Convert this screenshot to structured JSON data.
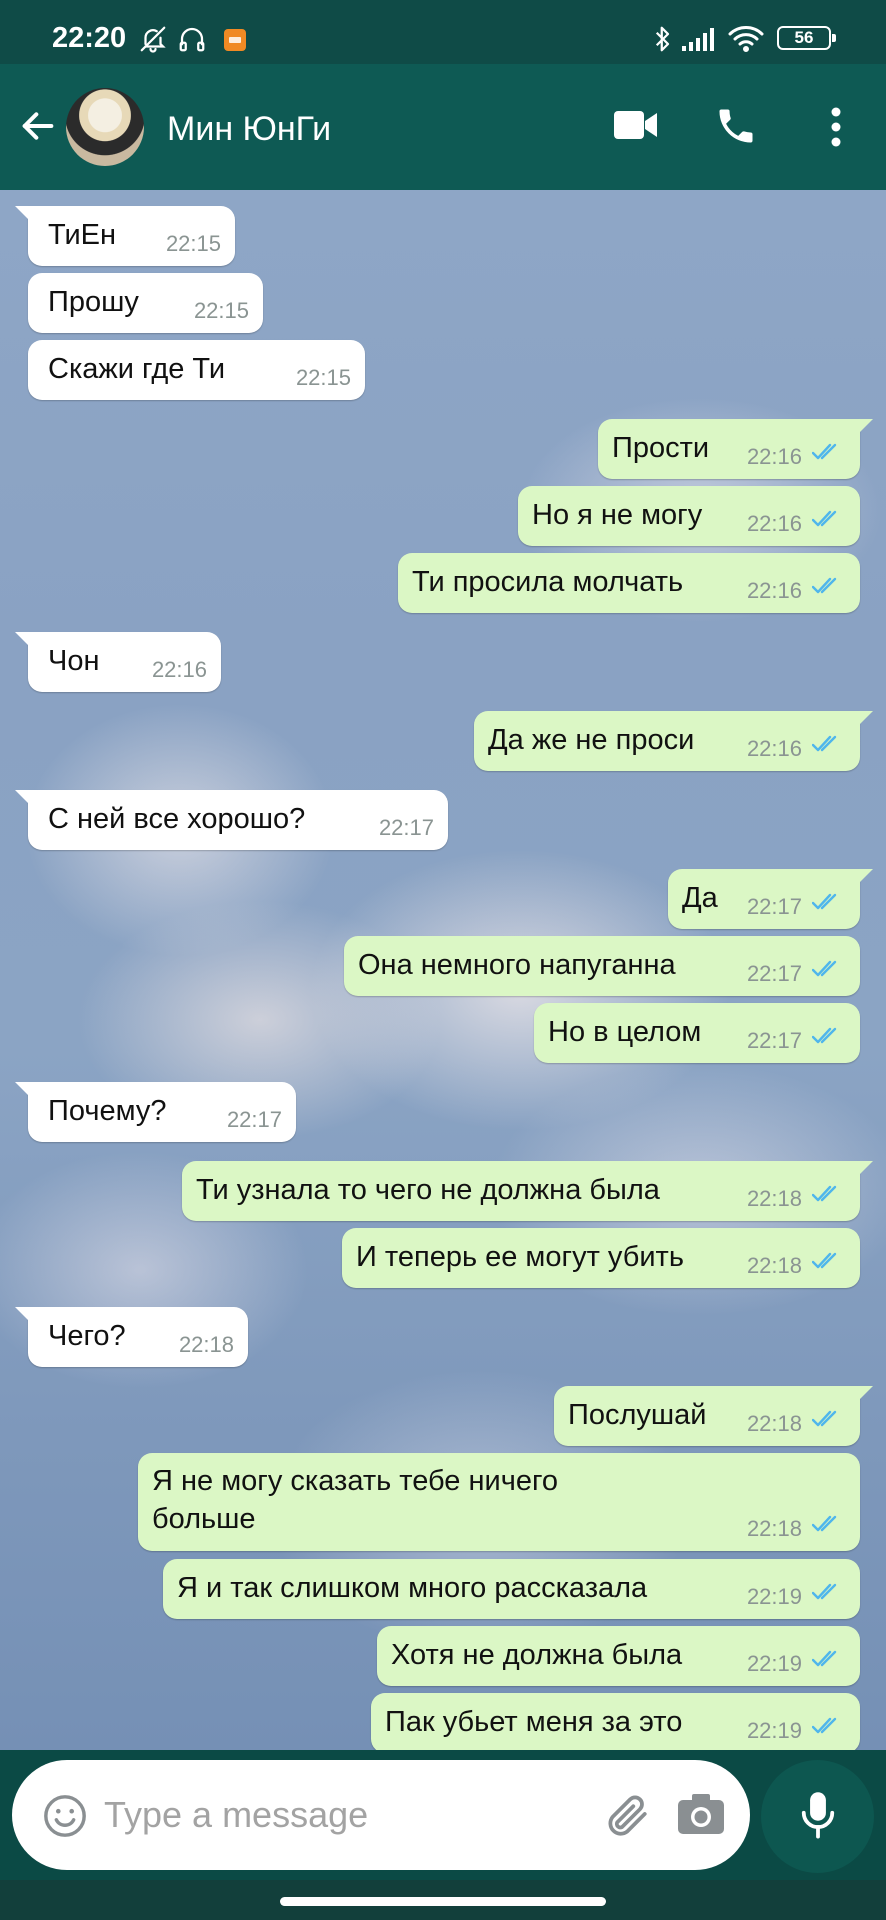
{
  "status_bar": {
    "time": "22:20",
    "battery": "56",
    "icons": [
      "bell-off-icon",
      "headphones-icon",
      "app-notification-icon",
      "bluetooth-icon",
      "signal-icon",
      "wifi-icon",
      "battery-icon"
    ]
  },
  "header": {
    "contact_name": "Мин ЮнГи",
    "icons": [
      "back-arrow-icon",
      "video-call-icon",
      "phone-call-icon",
      "more-vert-icon"
    ]
  },
  "messages": [
    {
      "dir": "in",
      "text": "ТиЕн",
      "time": "22:15"
    },
    {
      "dir": "in",
      "text": "Прошу",
      "time": "22:15"
    },
    {
      "dir": "in",
      "text": "Скажи где Ти",
      "time": "22:15"
    },
    {
      "dir": "out",
      "text": "Прости",
      "time": "22:16",
      "status": "read"
    },
    {
      "dir": "out",
      "text": "Но я не могу",
      "time": "22:16",
      "status": "read"
    },
    {
      "dir": "out",
      "text": "Ти просила молчать",
      "time": "22:16",
      "status": "read"
    },
    {
      "dir": "in",
      "text": "Чон",
      "time": "22:16"
    },
    {
      "dir": "out",
      "text": "Да же не проси",
      "time": "22:16",
      "status": "read"
    },
    {
      "dir": "in",
      "text": "С ней все хорошо?",
      "time": "22:17"
    },
    {
      "dir": "out",
      "text": "Да",
      "time": "22:17",
      "status": "read"
    },
    {
      "dir": "out",
      "text": "Она немного напуганна",
      "time": "22:17",
      "status": "read"
    },
    {
      "dir": "out",
      "text": "Но в целом",
      "time": "22:17",
      "status": "read"
    },
    {
      "dir": "in",
      "text": "Почему?",
      "time": "22:17"
    },
    {
      "dir": "out",
      "text": "Ти узнала то чего не должна была",
      "time": "22:18",
      "status": "read"
    },
    {
      "dir": "out",
      "text": "И теперь ее могут убить",
      "time": "22:18",
      "status": "read"
    },
    {
      "dir": "in",
      "text": "Чего?",
      "time": "22:18"
    },
    {
      "dir": "out",
      "text": "Послушай",
      "time": "22:18",
      "status": "read"
    },
    {
      "dir": "out",
      "text": "Я не могу сказать тебе ничего больше",
      "time": "22:18",
      "status": "read"
    },
    {
      "dir": "out",
      "text": "Я и так слишком много рассказала",
      "time": "22:19",
      "status": "read"
    },
    {
      "dir": "out",
      "text": "Хотя не должна была",
      "time": "22:19",
      "status": "read"
    },
    {
      "dir": "out",
      "text": "Пак убьет меня за это",
      "time": "22:19",
      "status": "read"
    }
  ],
  "composer": {
    "placeholder": "Type a message",
    "icons": [
      "emoji-icon",
      "attach-icon",
      "camera-icon",
      "mic-icon"
    ]
  },
  "colors": {
    "header_bg": "#0e5a54",
    "status_bar_bg": "#0f4b47",
    "incoming_bubble": "#ffffff",
    "outgoing_bubble": "#dbf7c5",
    "read_ticks": "#4fb6ec",
    "mic_button": "#0d5750"
  }
}
